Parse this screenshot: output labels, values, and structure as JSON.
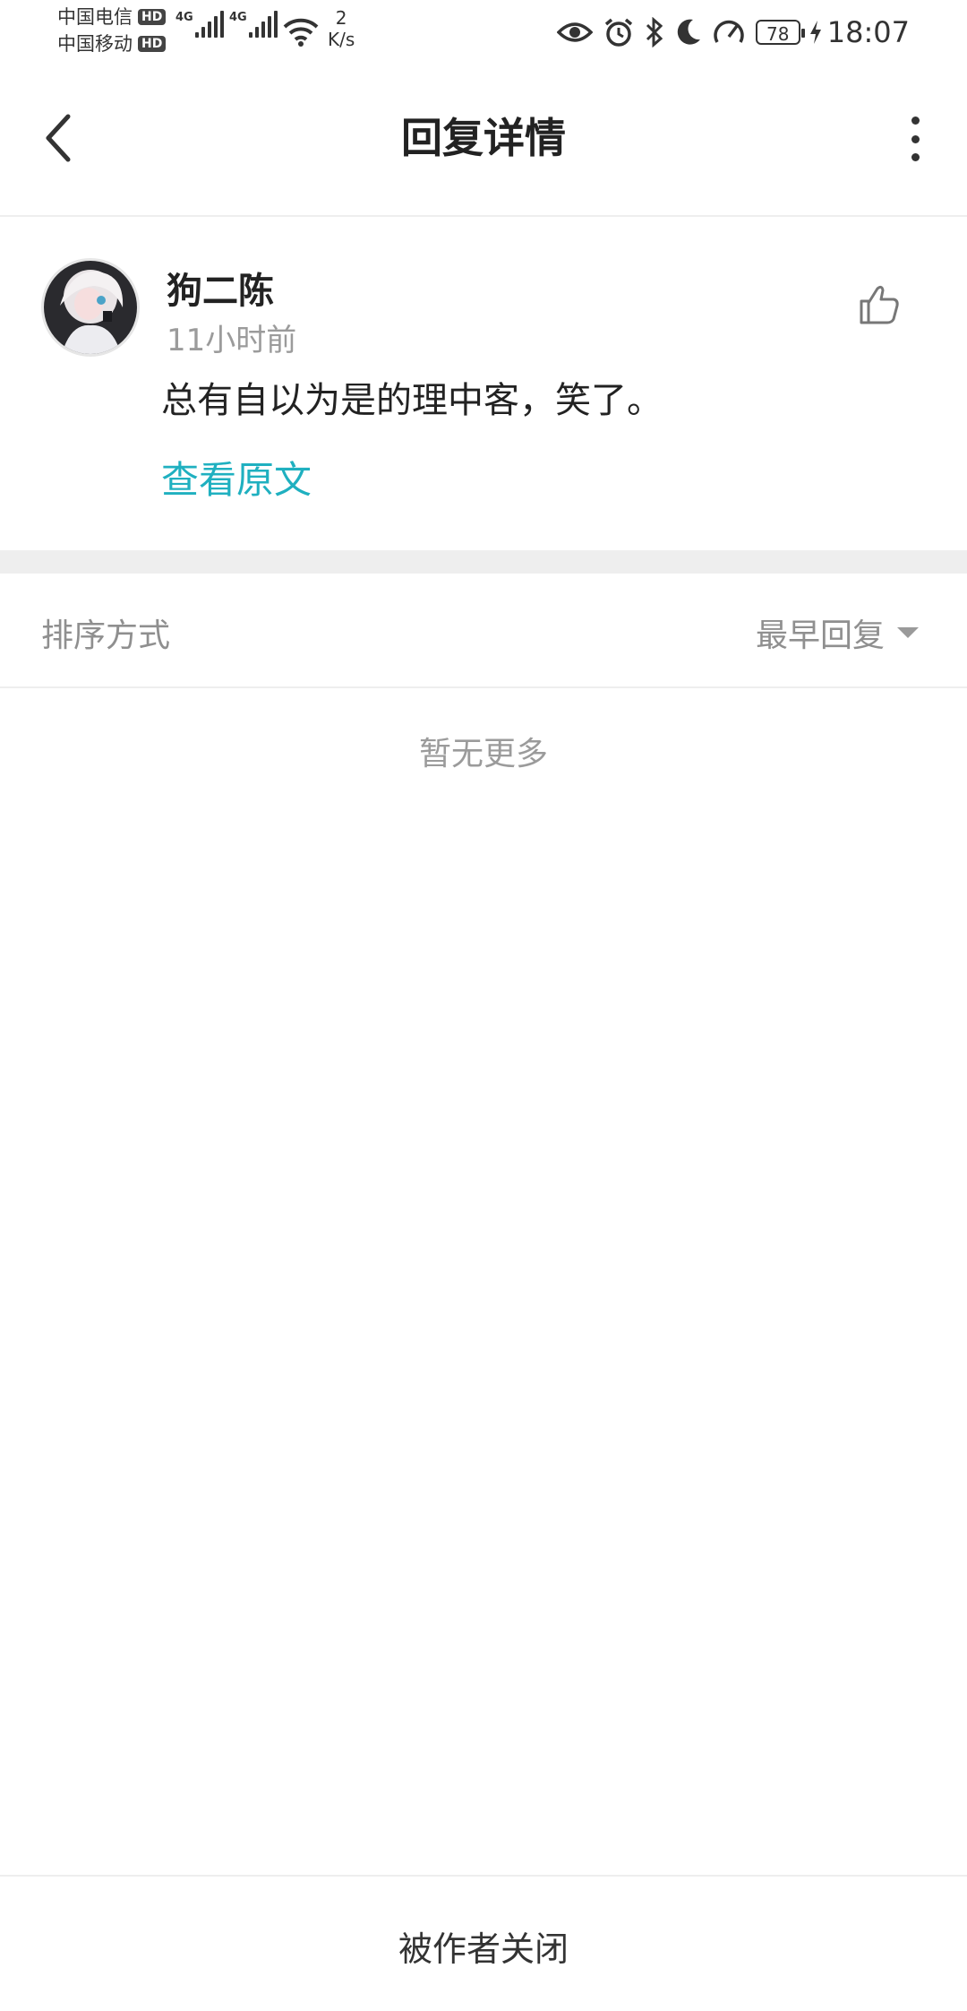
{
  "status_bar": {
    "carrier1": "中国电信",
    "carrier2": "中国移动",
    "hd_badge": "HD",
    "network_tag": "4G",
    "speed_value": "2",
    "speed_unit": "K/s",
    "battery": "78",
    "time": "18:07"
  },
  "header": {
    "title": "回复详情"
  },
  "comment": {
    "username": "狗二陈",
    "time_ago": "11小时前",
    "content": "总有自以为是的理中客，笑了。",
    "view_original": "查看原文"
  },
  "sort": {
    "label": "排序方式",
    "value": "最早回复"
  },
  "empty_text": "暂无更多",
  "footer": {
    "status": "被作者关闭"
  },
  "colors": {
    "accent": "#1fb0c0",
    "muted_text": "#9b9b9b",
    "divider": "#eeeeee"
  }
}
